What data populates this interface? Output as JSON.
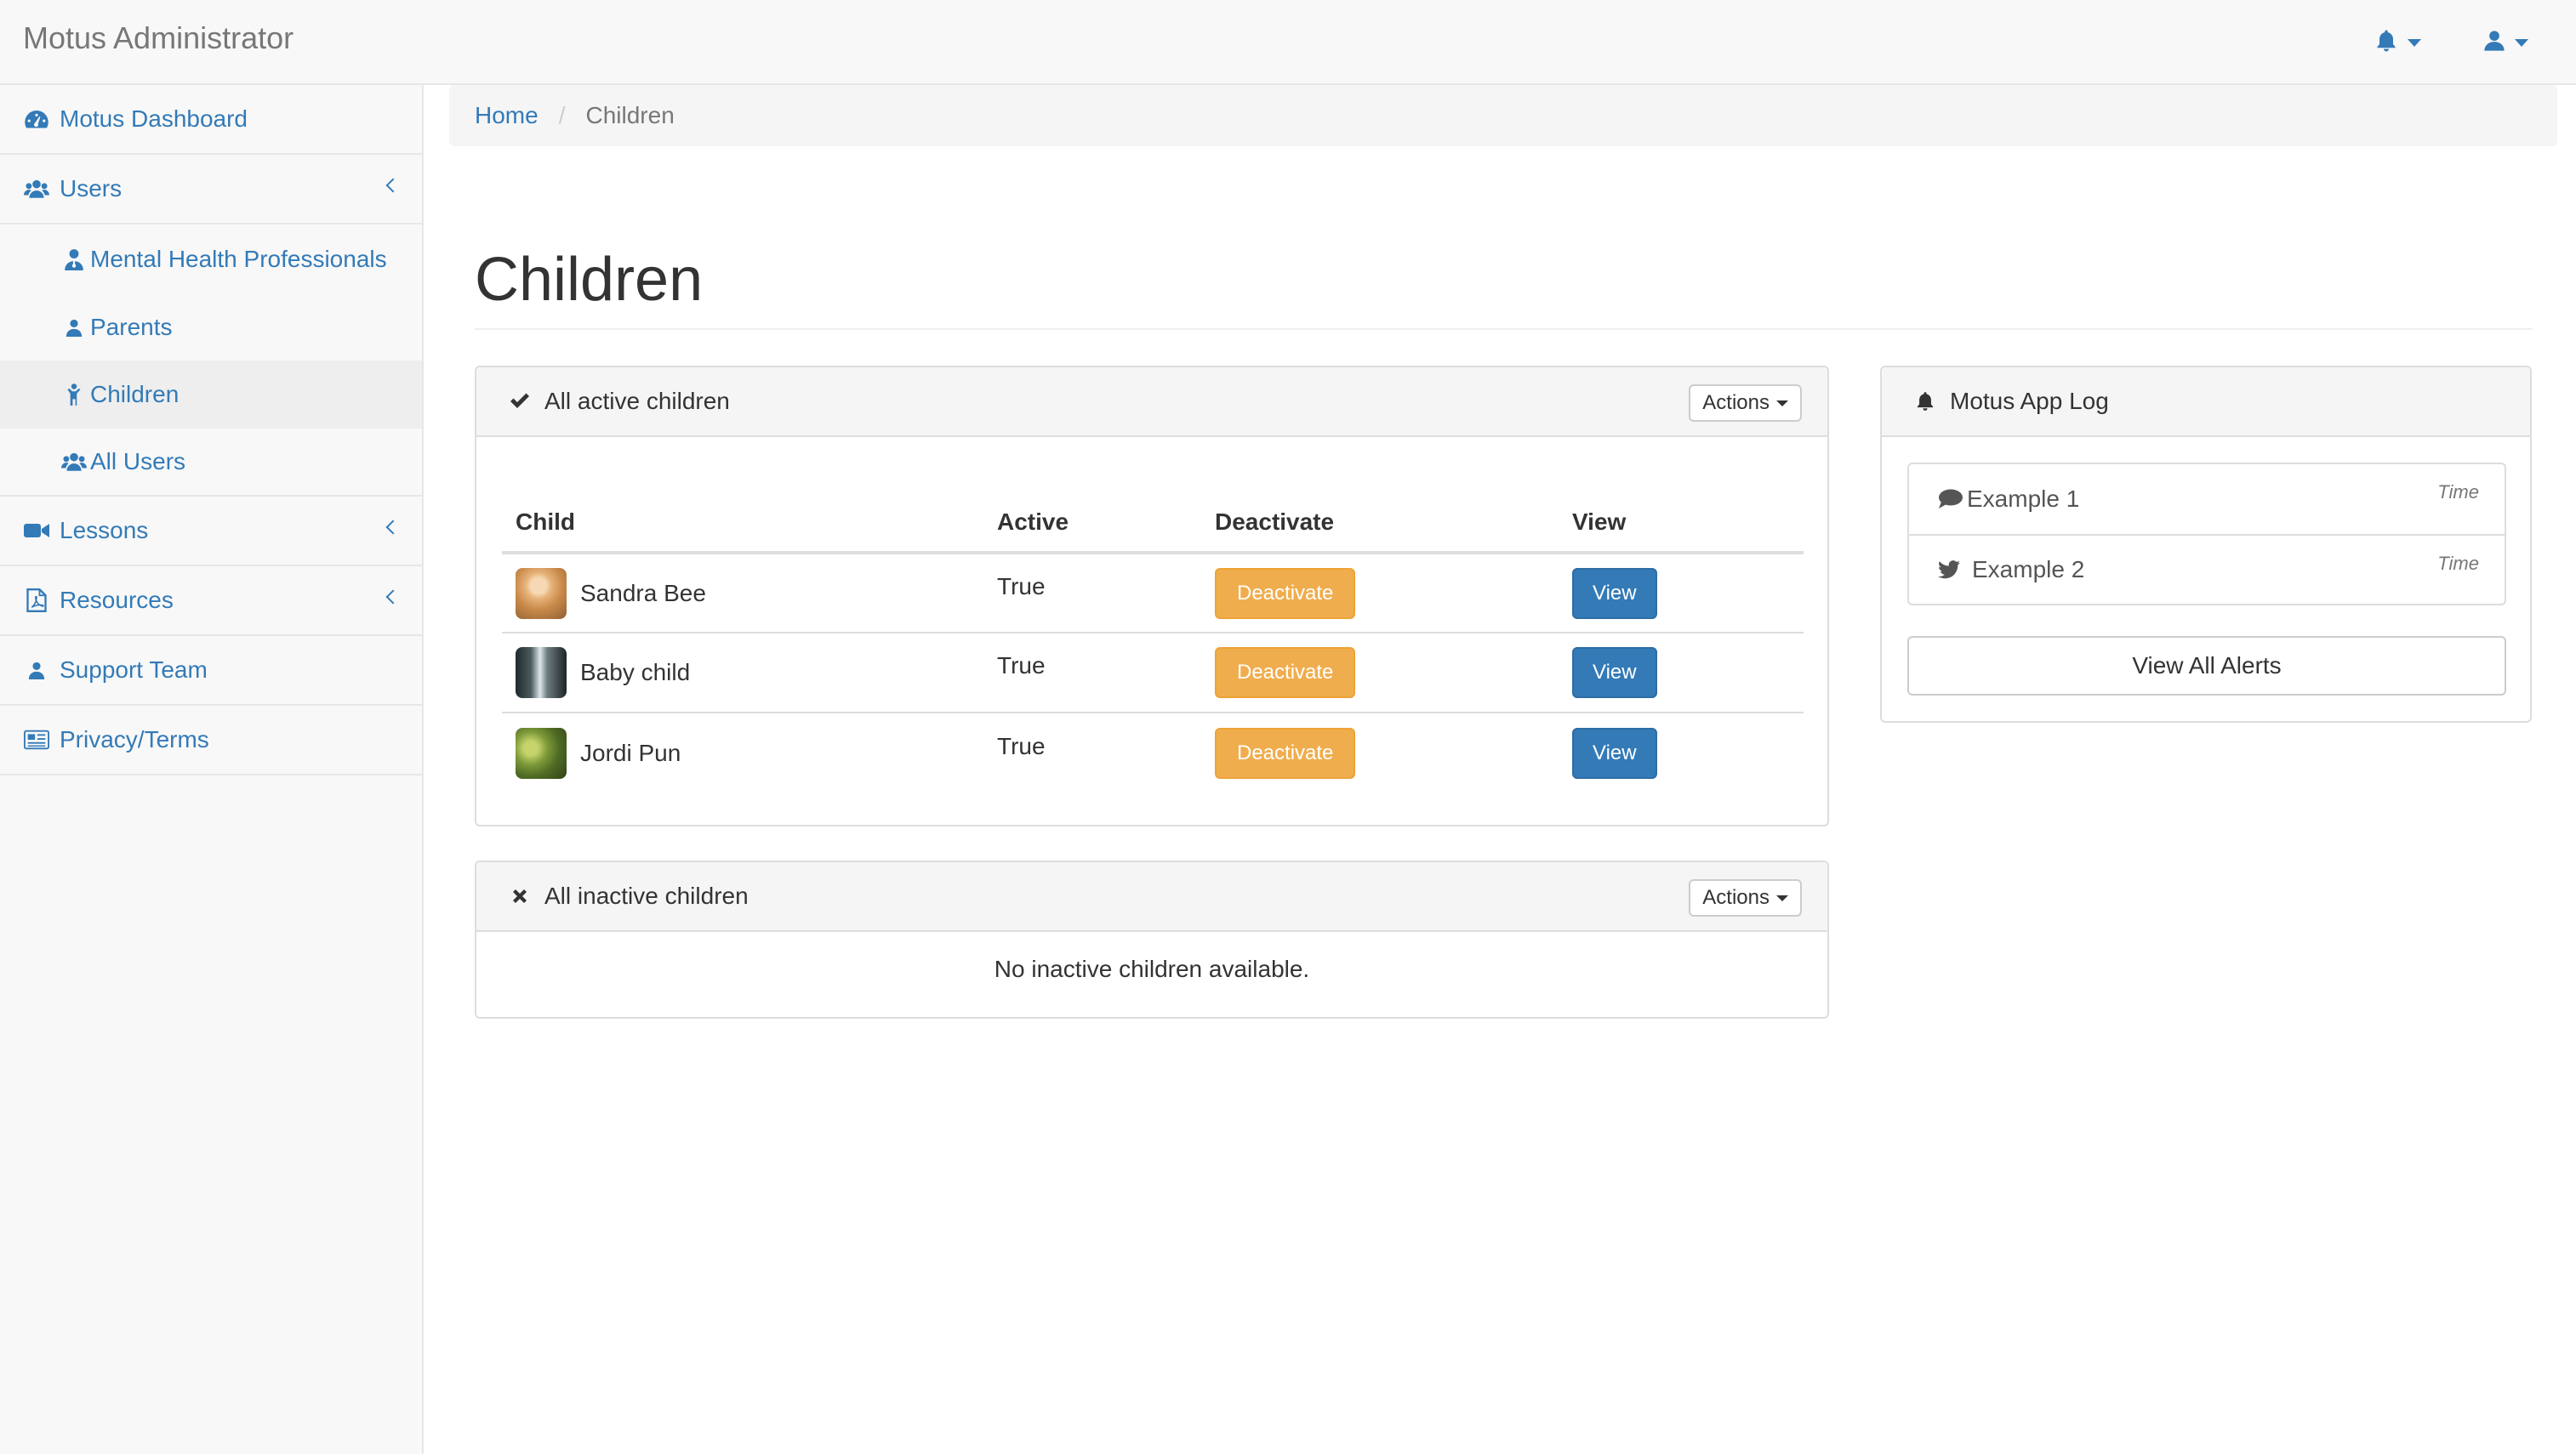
{
  "app": {
    "title": "Motus Administrator"
  },
  "navbar": {
    "alerts_icon": "bell-icon",
    "user_icon": "user-icon"
  },
  "sidebar": {
    "items": [
      {
        "label": "Motus Dashboard",
        "icon": "dashboard-icon"
      },
      {
        "label": "Users",
        "icon": "users-icon"
      },
      {
        "label": "Mental Health Professionals",
        "icon": "user-md-icon"
      },
      {
        "label": "Parents",
        "icon": "user-icon"
      },
      {
        "label": "Children",
        "icon": "child-icon"
      },
      {
        "label": "All Users",
        "icon": "users-icon"
      },
      {
        "label": "Lessons",
        "icon": "video-camera-icon"
      },
      {
        "label": "Resources",
        "icon": "file-pdf-icon"
      },
      {
        "label": "Support Team",
        "icon": "user-icon"
      },
      {
        "label": "Privacy/Terms",
        "icon": "newspaper-icon"
      }
    ]
  },
  "breadcrumb": {
    "home": "Home",
    "current": "Children"
  },
  "page": {
    "title": "Children"
  },
  "active_panel": {
    "heading": "All active children",
    "actions_label": "Actions",
    "columns": [
      "Child",
      "Active",
      "Deactivate",
      "View"
    ],
    "rows": [
      {
        "name": "Sandra Bee",
        "active": "True",
        "deactivate_label": "Deactivate",
        "view_label": "View"
      },
      {
        "name": "Baby child",
        "active": "True",
        "deactivate_label": "Deactivate",
        "view_label": "View"
      },
      {
        "name": "Jordi Pun",
        "active": "True",
        "deactivate_label": "Deactivate",
        "view_label": "View"
      }
    ]
  },
  "inactive_panel": {
    "heading": "All inactive children",
    "actions_label": "Actions",
    "empty_message": "No inactive children available."
  },
  "log_panel": {
    "heading": "Motus App Log",
    "items": [
      {
        "label": "Example 1",
        "time": "Time",
        "icon": "comment-icon"
      },
      {
        "label": "Example 2",
        "time": "Time",
        "icon": "twitter-icon"
      }
    ],
    "view_all_label": "View All Alerts"
  },
  "colors": {
    "link": "#337ab7",
    "warning": "#f0ad4e",
    "primary": "#337ab7"
  }
}
